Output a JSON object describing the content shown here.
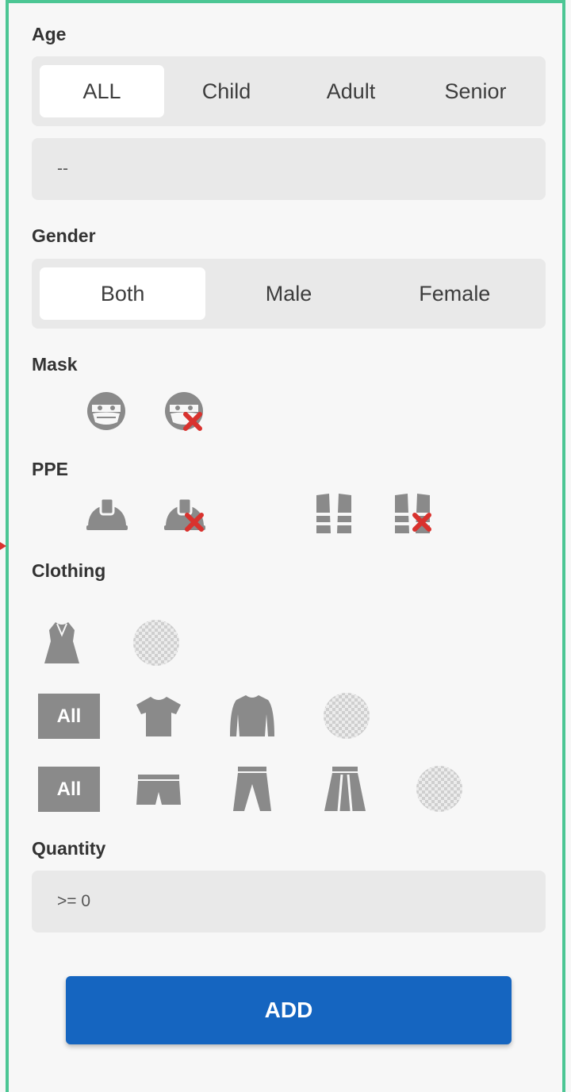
{
  "age": {
    "label": "Age",
    "options": [
      "ALL",
      "Child",
      "Adult",
      "Senior"
    ],
    "selected": "ALL",
    "range_value": "--"
  },
  "gender": {
    "label": "Gender",
    "options": [
      "Both",
      "Male",
      "Female"
    ],
    "selected": "Both"
  },
  "mask": {
    "label": "Mask",
    "icons": [
      "mask-on-icon",
      "mask-off-icon"
    ]
  },
  "ppe": {
    "label": "PPE",
    "icons": [
      "hardhat-icon",
      "no-hardhat-icon",
      "safety-vest-icon",
      "no-safety-vest-icon"
    ]
  },
  "clothing": {
    "label": "Clothing",
    "full_body_icons": [
      "dress-icon",
      "any-full-body-icon"
    ],
    "upper_all_label": "All",
    "upper_icons": [
      "tshirt-icon",
      "long-sleeve-icon",
      "any-upper-icon"
    ],
    "lower_all_label": "All",
    "lower_icons": [
      "shorts-icon",
      "trousers-icon",
      "skirt-icon",
      "any-lower-icon"
    ]
  },
  "quantity": {
    "label": "Quantity",
    "value": ">= 0"
  },
  "add_label": "ADD",
  "colors": {
    "border": "#4cc694",
    "icon_gray": "#8a8a8a",
    "cross_red": "#d9322e",
    "primary": "#1565c0",
    "segment_bg": "#e9e9e9"
  }
}
